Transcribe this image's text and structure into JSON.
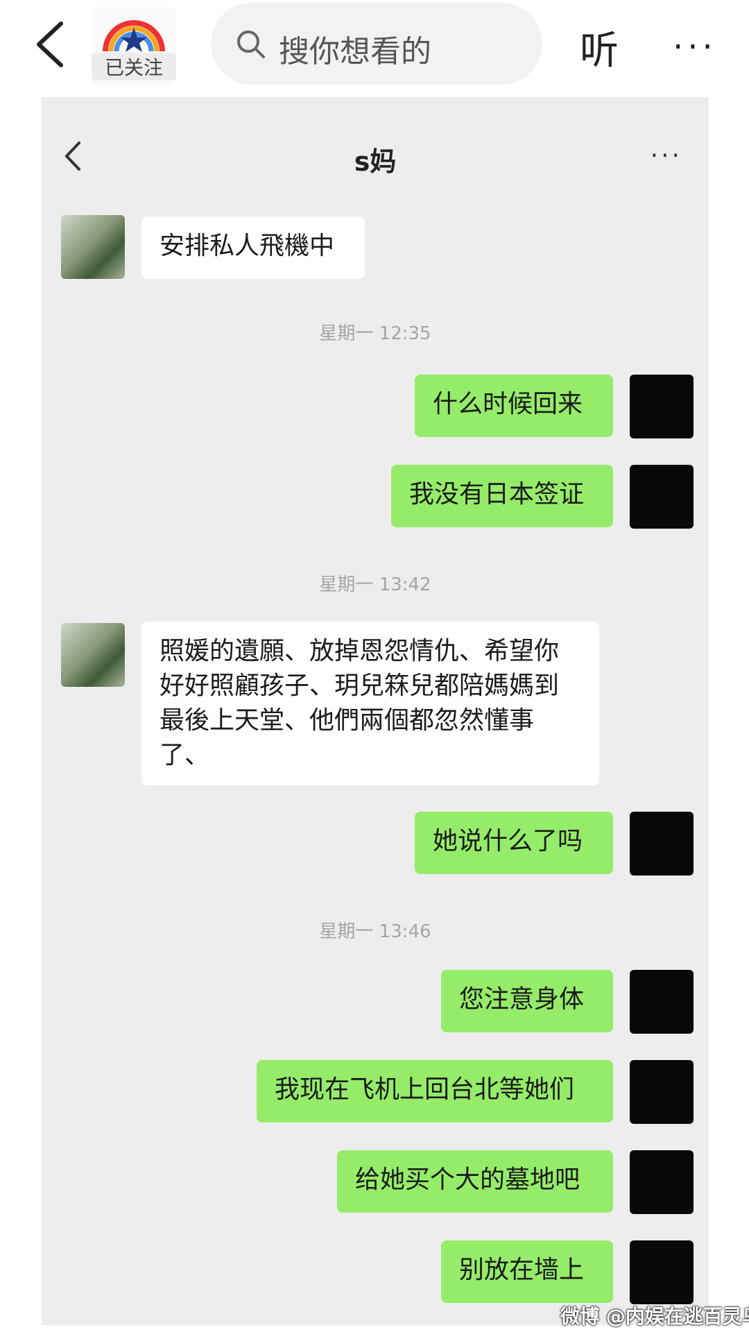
{
  "header": {
    "follow_label": "已关注",
    "search_placeholder": "搜你想看的",
    "listen_label": "听",
    "more_label": "···"
  },
  "chat": {
    "title": "s妈",
    "more_label": "···",
    "messages": [
      {
        "side": "in",
        "text": "安排私人飛機中"
      },
      {
        "timestamp": "星期一 12:35"
      },
      {
        "side": "out",
        "text": "什么时候回来"
      },
      {
        "side": "out",
        "text": "我没有日本签证"
      },
      {
        "timestamp": "星期一 13:42"
      },
      {
        "side": "in",
        "text": "照媛的遺願、放掉恩怨情仇、希望你好好照顧孩子、玥兒箖兒都陪媽媽到最後上天堂、他們兩個都忽然懂事了、"
      },
      {
        "side": "out",
        "text": "她说什么了吗"
      },
      {
        "timestamp": "星期一 13:46"
      },
      {
        "side": "out",
        "text": "您注意身体"
      },
      {
        "side": "out",
        "text": "我现在飞机上回台北等她们"
      },
      {
        "side": "out",
        "text": "给她买个大的墓地吧"
      },
      {
        "side": "out",
        "text": "别放在墙上"
      }
    ]
  },
  "watermark": "微博 @内娱在逃百灵鸟",
  "colors": {
    "outgoing_bubble": "#95ec69",
    "incoming_bubble": "#ffffff",
    "chat_bg": "#ededed"
  }
}
